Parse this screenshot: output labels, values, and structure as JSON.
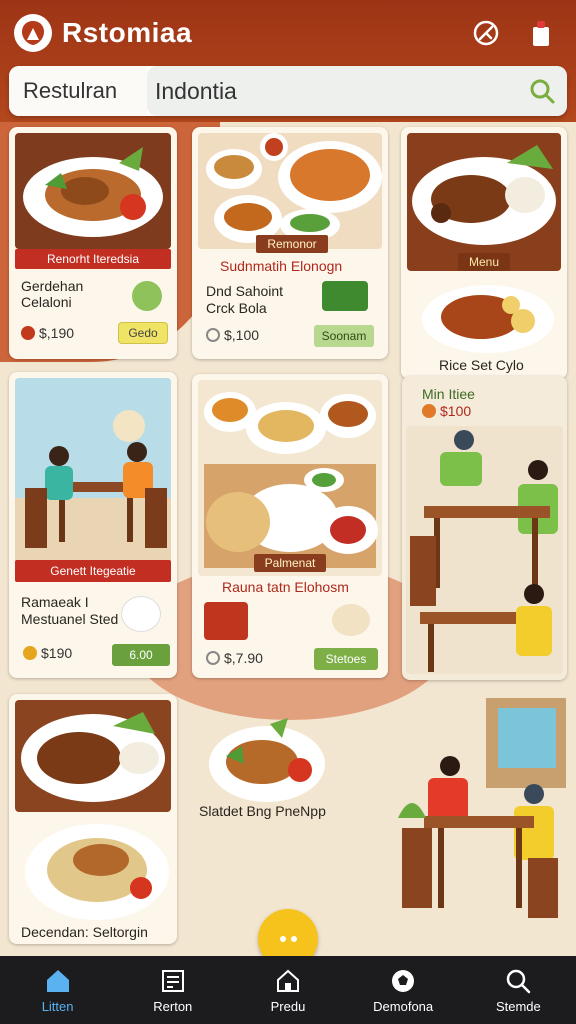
{
  "app": {
    "title": "Rstomiaa"
  },
  "search": {
    "category": "Restulran",
    "value": "Indontia"
  },
  "cards": {
    "c1": {
      "tag": "Renorht Iteredsia",
      "title1": "Gerdehan Celaloni",
      "price": "$,190",
      "badge": "Gedo"
    },
    "c2": {
      "tag": "Remonor",
      "subtitle": "Sudnmatih Elonogn",
      "title1": "Dnd Sahoint",
      "title2": "Crck Bola",
      "price": "$,100",
      "badge": "Soonam"
    },
    "c3": {
      "tag": "Menu",
      "caption": "Rice Set Cylo"
    },
    "c4": {
      "tag": "Genett Itegeatie",
      "title1": "Ramaeak I",
      "title2": "Mestuanel Sted",
      "price": "$190",
      "badge": "6.00"
    },
    "c5": {
      "tag": "Palmenat",
      "subtitle": "Rauna tatn Elohosm",
      "price": "$,7.90",
      "badge": "Stetoes"
    },
    "c6": {
      "title": "Min Itiee",
      "price": "$100"
    },
    "c7": {
      "caption": "Decendan: Seltorgin"
    },
    "c8": {
      "caption": "Slatdet Bng PneNpp"
    }
  },
  "nav": [
    {
      "label": "Litten",
      "icon": "home-icon"
    },
    {
      "label": "Rerton",
      "icon": "menu-board-icon"
    },
    {
      "label": "Predu",
      "icon": "store-icon"
    },
    {
      "label": "Demofona",
      "icon": "soccer-ball-icon"
    },
    {
      "label": "Stemde",
      "icon": "search-icon"
    }
  ],
  "colors": {
    "header": "#a63a17",
    "accent_green": "#6aa13d",
    "nav_active": "#5ab3f0",
    "fab": "#f6c21c"
  }
}
